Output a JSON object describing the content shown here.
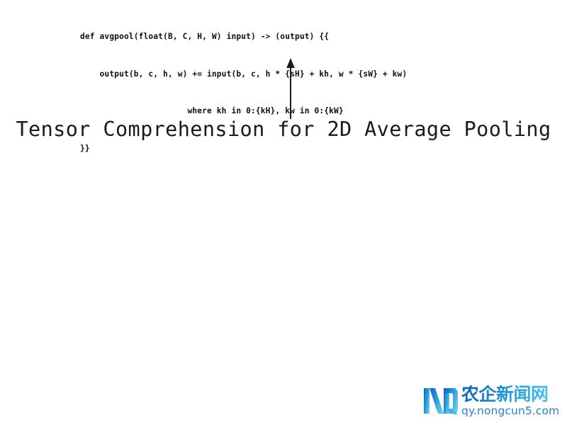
{
  "slide": {
    "background_color": "#ffffff",
    "code": {
      "language": "tensor-comprehension",
      "text_color": "#101010",
      "lines": [
        "def avgpool(float(B, C, H, W) input) -> (output) {{",
        "    output(b, c, h, w) += input(b, c, h * {sH} + kh, w * {sW} + kw)",
        "                      where kh in 0:{kH}, kw in 0:{kW}",
        "}}"
      ]
    },
    "arrow": {
      "name": "up-arrow",
      "direction": "up",
      "color": "#1a1a1a"
    },
    "title": {
      "text": "Tensor Comprehension for 2D Average Pooling",
      "color": "#1a1a1a"
    },
    "watermark": {
      "logo_monogram": "ND",
      "site_name": "农企新闻网",
      "url": "qy.nongcun5.com",
      "accent_color": "#2a7fc9",
      "gradient_start": "#0d63b8",
      "gradient_end": "#63c9ee"
    }
  }
}
